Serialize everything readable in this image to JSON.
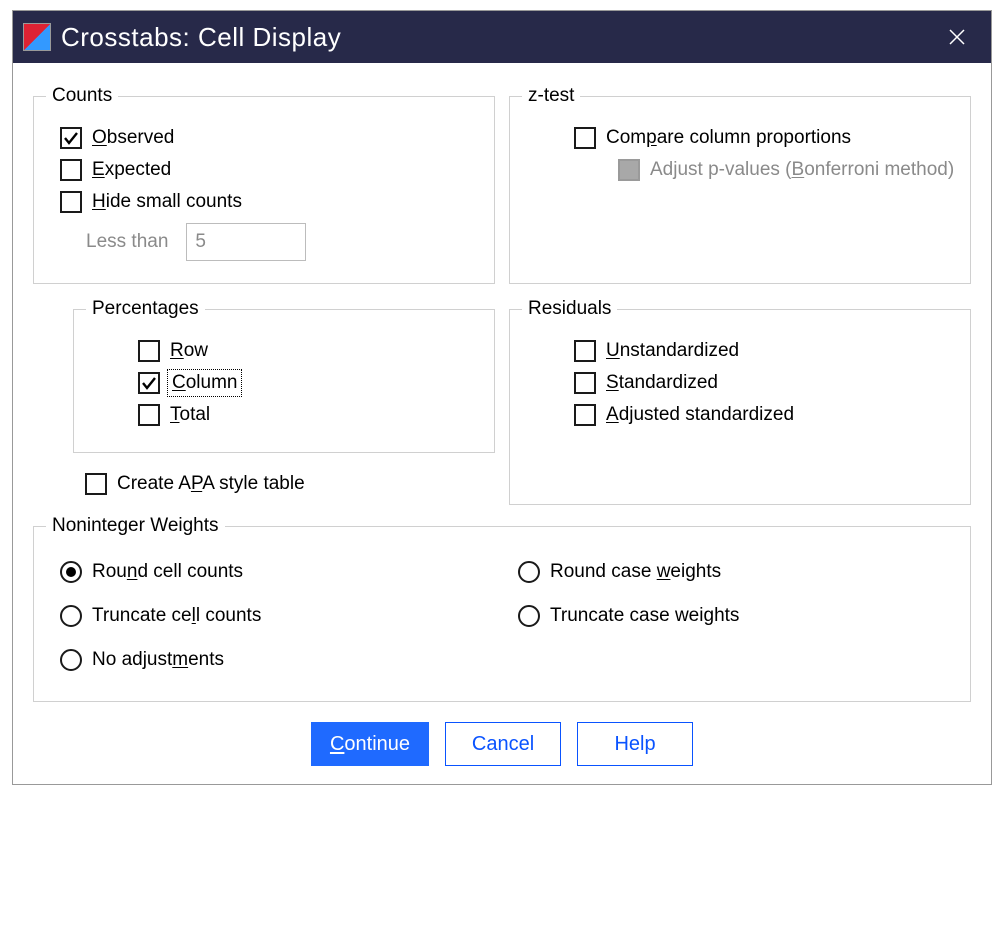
{
  "title": "Crosstabs: Cell Display",
  "counts": {
    "legend": "Counts",
    "observed_html": "<span class='u'>O</span>bserved",
    "observed_checked": true,
    "expected_html": "<span class='u'>E</span>xpected",
    "expected_checked": false,
    "hide_html": "<span class='u'>H</span>ide small counts",
    "hide_checked": false,
    "less_than_label": "Less than",
    "less_than_value": "5"
  },
  "ztest": {
    "legend": "z-test",
    "compare_html": "Com<span class='u'>p</span>are column proportions",
    "compare_checked": false,
    "adjust_html": "Adjust p-values (<span class='u'>B</span>onferroni method)",
    "adjust_enabled": false,
    "adjust_checked": false
  },
  "percentages": {
    "legend": "Percentages",
    "row_html": "<span class='u'>R</span>ow",
    "row_checked": false,
    "column_html": "<span class='u'>C</span>olumn",
    "column_checked": true,
    "total_html": "<span class='u'>T</span>otal",
    "total_checked": false
  },
  "apa_html": "Create A<span class='u'>P</span>A style table",
  "apa_checked": false,
  "residuals": {
    "legend": "Residuals",
    "unstd_html": "<span class='u'>U</span>nstandardized",
    "unstd_checked": false,
    "std_html": "<span class='u'>S</span>tandardized",
    "std_checked": false,
    "adj_html": "<span class='u'>A</span>djusted standardized",
    "adj_checked": false
  },
  "noninteger": {
    "legend": "Noninteger Weights",
    "options": {
      "round_cell_html": "Rou<span class='u'>n</span>d cell counts",
      "round_case_html": "Round case <span class='u'>w</span>eights",
      "trunc_cell_html": "Truncate ce<span class='u'>l</span>l counts",
      "trunc_case_html": "Truncate case wei<span class='u'>g</span>hts",
      "none_html": "No adjust<span class='u'>m</span>ents"
    },
    "selected": "round_cell"
  },
  "buttons": {
    "continue_html": "<span class='u'>C</span>ontinue",
    "cancel": "Cancel",
    "help": "Help"
  }
}
